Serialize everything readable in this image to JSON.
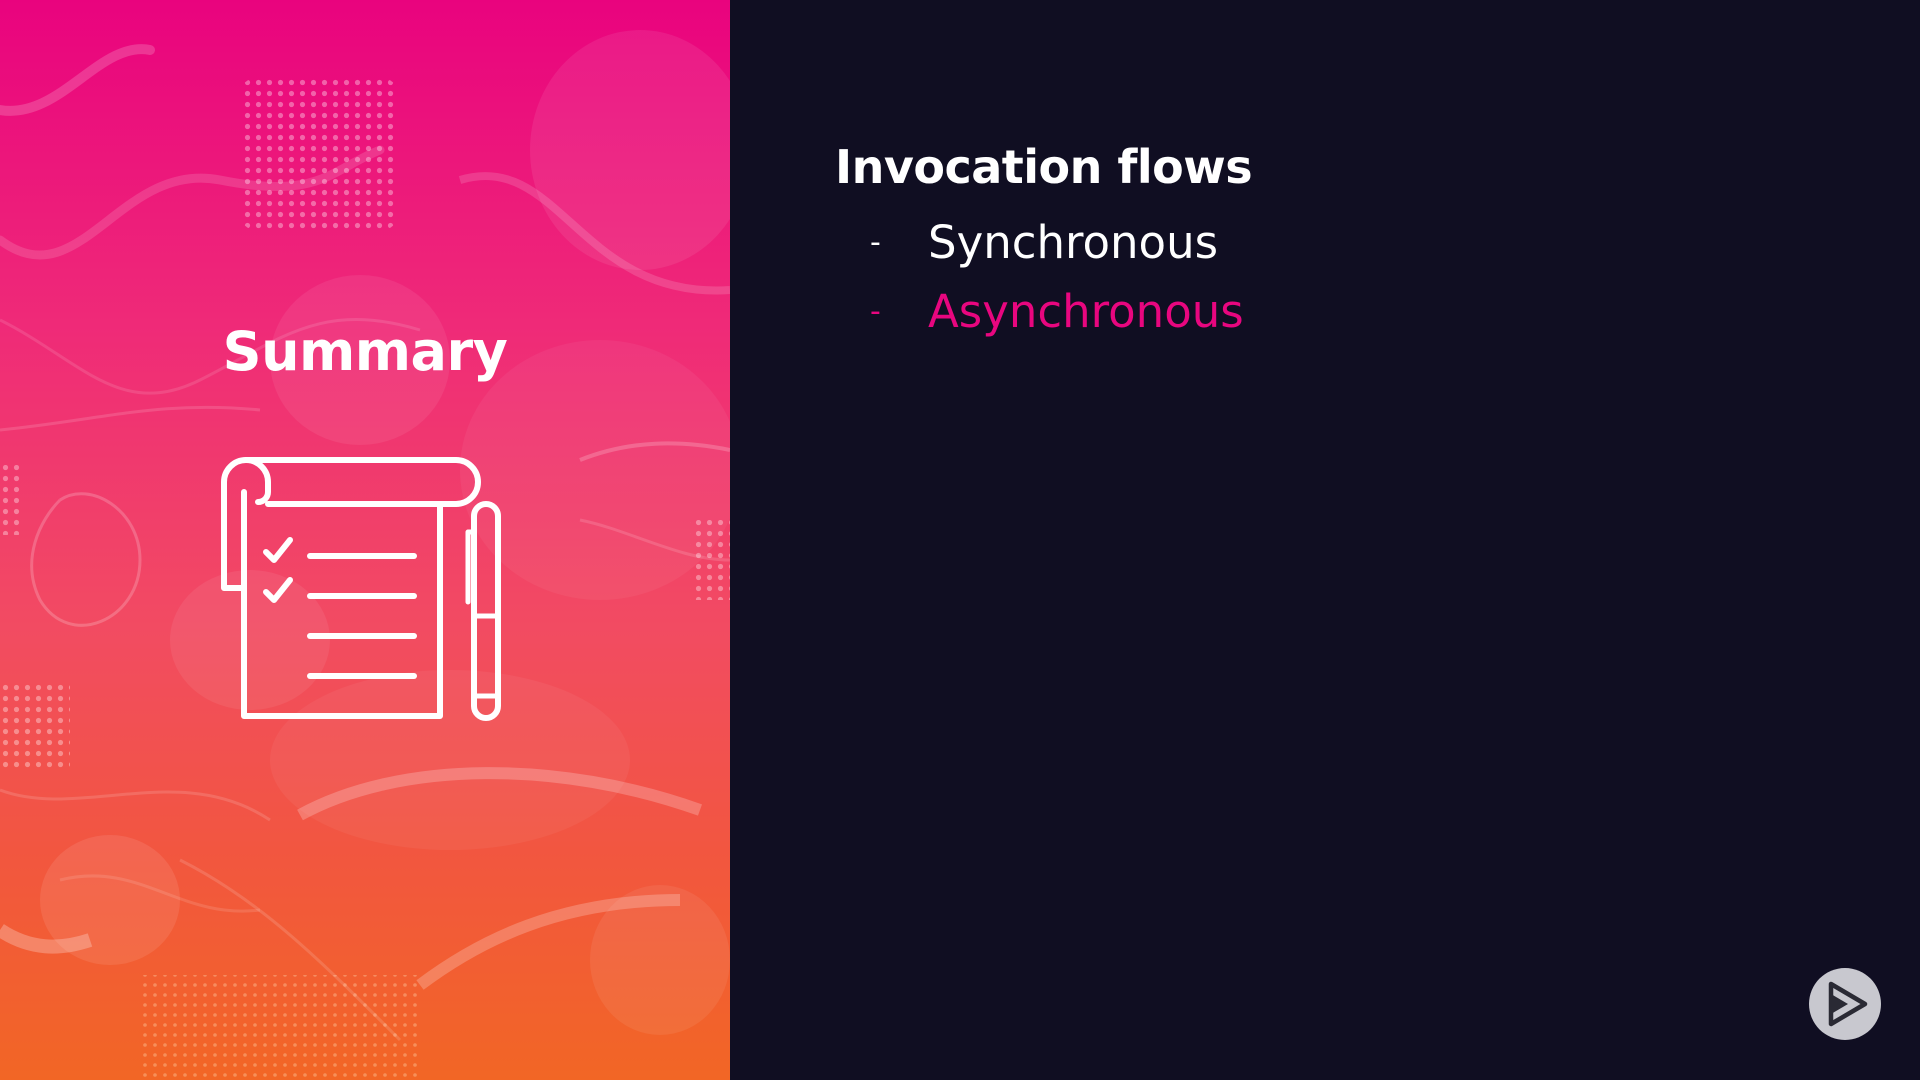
{
  "left_panel": {
    "title": "Summary",
    "icon": "checklist-notepad-with-pen-icon",
    "gradient_colors": [
      "#e9037e",
      "#f24b62",
      "#f26625"
    ]
  },
  "right_panel": {
    "heading": "Invocation flows",
    "items": [
      {
        "dash": "-",
        "label": "Synchronous",
        "state": "normal"
      },
      {
        "dash": "-",
        "label": "Asynchronous",
        "state": "highlighted"
      }
    ],
    "colors": {
      "background": "#100e22",
      "text": "#ffffff",
      "highlight": "#e8067f"
    }
  },
  "branding": {
    "logo": "play-logo-icon"
  }
}
